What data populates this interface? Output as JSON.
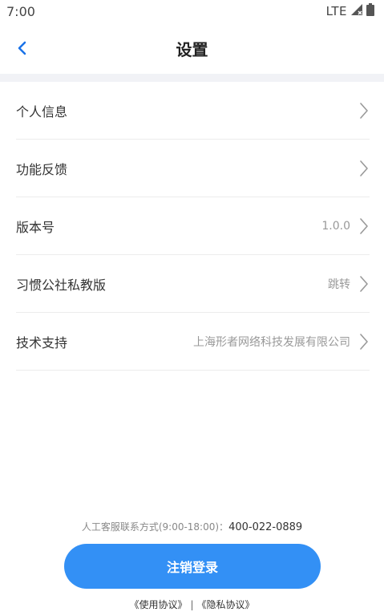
{
  "status_bar": {
    "time": "7:00",
    "network": "LTE"
  },
  "header": {
    "title": "设置"
  },
  "settings": [
    {
      "label": "个人信息",
      "value": ""
    },
    {
      "label": "功能反馈",
      "value": ""
    },
    {
      "label": "版本号",
      "value": "1.0.0"
    },
    {
      "label": "习惯公社私教版",
      "value": "跳转"
    },
    {
      "label": "技术支持",
      "value": "上海形者网络科技发展有限公司"
    }
  ],
  "contact": {
    "label": "人工客服联系方式(9:00-18:00)：",
    "phone": "400-022-0889"
  },
  "logout": {
    "label": "注销登录"
  },
  "agreements": {
    "terms": "《使用协议》",
    "separator": "|",
    "privacy": "《隐私协议》"
  },
  "colors": {
    "accent": "#3390f5",
    "divider_band": "#f1f2f6",
    "back_arrow": "#1a73e8"
  }
}
